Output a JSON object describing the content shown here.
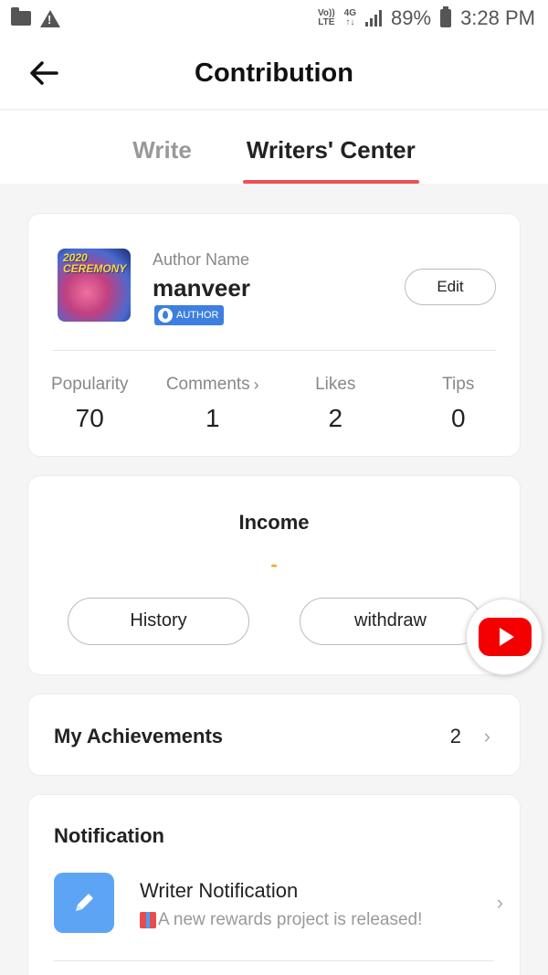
{
  "status_bar": {
    "volte": "Vo)) LTE",
    "network": "4G",
    "battery": "89%",
    "time": "3:28 PM",
    "icons": [
      "folder-icon",
      "warning-icon",
      "signal-icon",
      "battery-icon"
    ]
  },
  "app_bar": {
    "title": "Contribution",
    "back_icon": "arrow-left-icon"
  },
  "tabs": [
    {
      "label": "Write",
      "active": false
    },
    {
      "label": "Writers' Center",
      "active": true
    }
  ],
  "profile": {
    "avatar_text": "2020 CEREMONY",
    "author_label": "Author Name",
    "author_name": "manveer",
    "badge": "AUTHOR",
    "edit_label": "Edit",
    "stats": [
      {
        "label": "Popularity",
        "value": "70"
      },
      {
        "label": "Comments",
        "value": "1",
        "has_chevron": true
      },
      {
        "label": "Likes",
        "value": "2"
      },
      {
        "label": "Tips",
        "value": "0"
      }
    ]
  },
  "income": {
    "title": "Income",
    "value": "-",
    "history_label": "History",
    "withdraw_label": "withdraw"
  },
  "achievements": {
    "title": "My Achievements",
    "count": "2"
  },
  "notification": {
    "title": "Notification",
    "item_title": "Writer Notification",
    "item_desc": "A new rewards project is released!"
  },
  "colors": {
    "accent": "#ef4f4f",
    "income": "#f5a623",
    "badge": "#3d7fe0",
    "notif_icon": "#5ea4f5",
    "youtube": "#f50000"
  }
}
